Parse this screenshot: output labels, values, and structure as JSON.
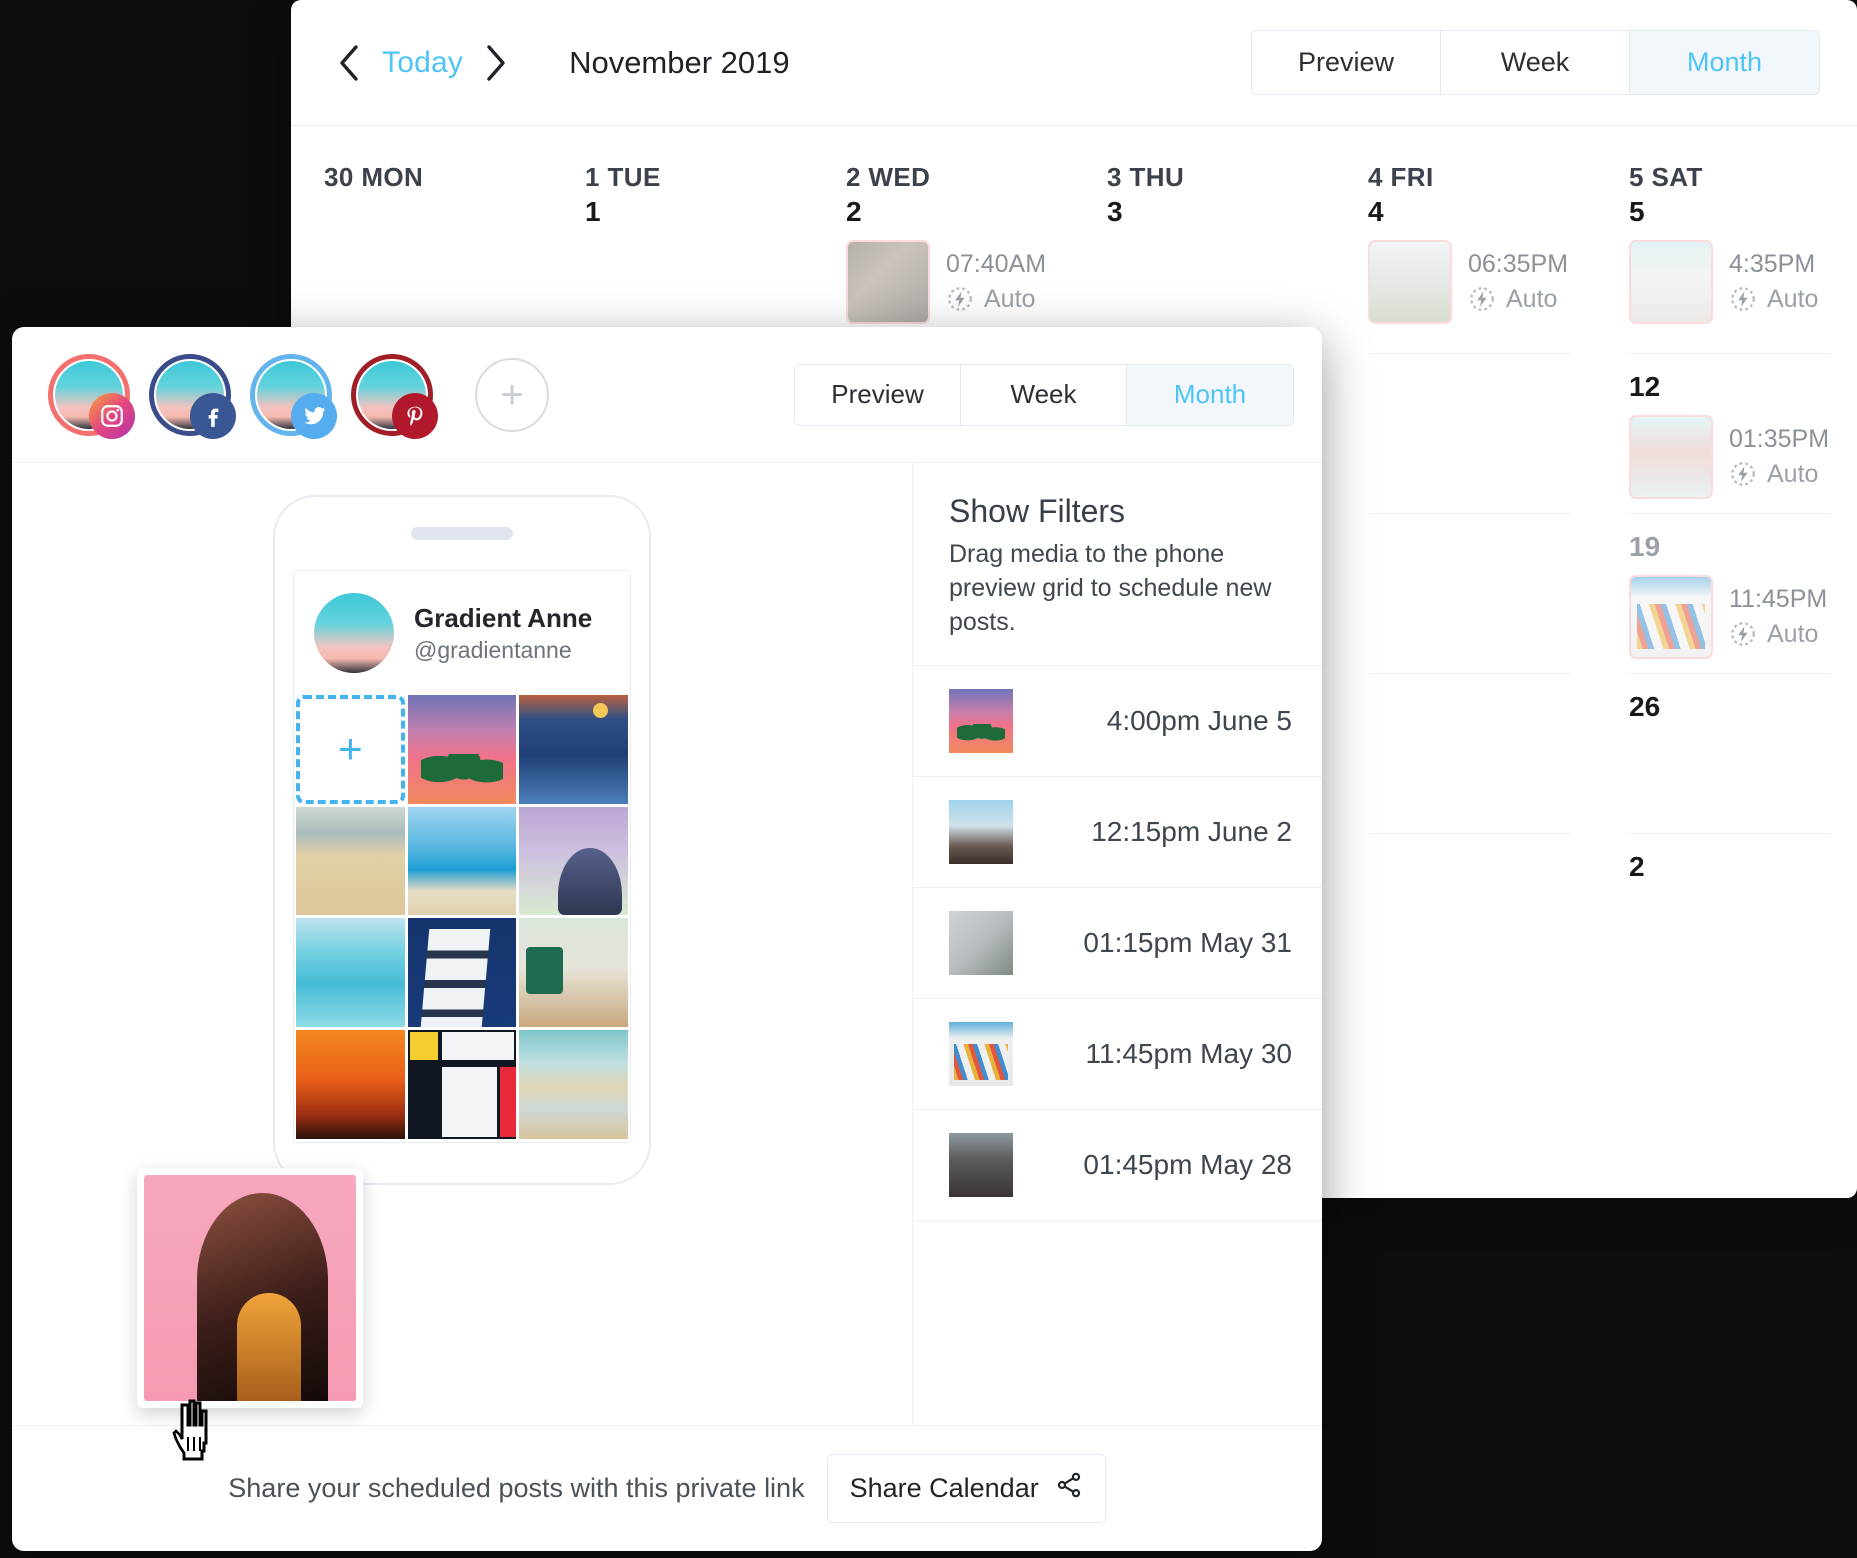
{
  "calendar": {
    "nav": {
      "prev": "‹",
      "today": "Today",
      "next": "›"
    },
    "title": "November 2019",
    "view_tabs": [
      {
        "label": "Preview",
        "active": false
      },
      {
        "label": "Week",
        "active": false
      },
      {
        "label": "Month",
        "active": true
      }
    ],
    "columns": [
      {
        "header": "30 MON",
        "weeks": [
          {
            "daynum": "",
            "posts": []
          },
          {
            "daynum": "",
            "posts": []
          },
          {
            "daynum": "",
            "posts": []
          },
          {
            "daynum": "",
            "posts": []
          },
          {
            "daynum": "",
            "posts": []
          }
        ]
      },
      {
        "header": "1 TUE",
        "weeks": [
          {
            "daynum": "1",
            "posts": []
          },
          {
            "daynum": "",
            "posts": []
          },
          {
            "daynum": "",
            "posts": []
          },
          {
            "daynum": "",
            "posts": []
          },
          {
            "daynum": "",
            "posts": []
          }
        ]
      },
      {
        "header": "2 WED",
        "weeks": [
          {
            "daynum": "2",
            "posts": [
              {
                "time": "07:40AM",
                "auto": "Auto",
                "thumb": "ph-brunch"
              }
            ]
          },
          {
            "daynum": "",
            "posts": []
          },
          {
            "daynum": "",
            "posts": []
          },
          {
            "daynum": "",
            "posts": []
          },
          {
            "daynum": "",
            "posts": []
          }
        ]
      },
      {
        "header": "3 THU",
        "weeks": [
          {
            "daynum": "3",
            "posts": []
          },
          {
            "daynum": "",
            "posts": []
          },
          {
            "daynum": "",
            "posts": []
          },
          {
            "daynum": "",
            "posts": []
          },
          {
            "daynum": "",
            "posts": []
          }
        ]
      },
      {
        "header": "4 FRI",
        "weeks": [
          {
            "daynum": "4",
            "posts": [
              {
                "time": "06:35PM",
                "auto": "Auto",
                "thumb": "ph-street"
              }
            ]
          },
          {
            "daynum": "",
            "posts": []
          },
          {
            "daynum": "",
            "posts": []
          },
          {
            "daynum": "",
            "posts": []
          },
          {
            "daynum": "",
            "posts": []
          }
        ]
      },
      {
        "header": "5 SAT",
        "weeks": [
          {
            "daynum": "5",
            "posts": [
              {
                "time": "4:35PM",
                "auto": "Auto",
                "thumb": "ph-sandals"
              }
            ]
          },
          {
            "daynum": "12",
            "posts": [
              {
                "time": "01:35PM",
                "auto": "Auto",
                "thumb": "ph-drinks"
              }
            ]
          },
          {
            "daynum": "19",
            "muted": true,
            "posts": [
              {
                "time": "11:45PM",
                "auto": "Auto",
                "thumb": "ph-mural"
              }
            ]
          },
          {
            "daynum": "26",
            "posts": []
          },
          {
            "daynum": "2",
            "posts": []
          }
        ]
      }
    ]
  },
  "composer": {
    "accounts": [
      {
        "network": "instagram",
        "ring": "#f4706e",
        "badge_bg": "linear-gradient(135deg,#f9a23b,#e4467f,#b033a8)"
      },
      {
        "network": "facebook",
        "ring": "#3b4c8a",
        "badge_bg": "#3a5795"
      },
      {
        "network": "twitter",
        "ring": "#63b3ec",
        "badge_bg": "#55acee"
      },
      {
        "network": "pinterest",
        "ring": "#a01e28",
        "badge_bg": "#b2182b"
      }
    ],
    "add_account_label": "+",
    "view_tabs": [
      {
        "label": "Preview",
        "active": false
      },
      {
        "label": "Week",
        "active": false
      },
      {
        "label": "Month",
        "active": true
      }
    ],
    "profile": {
      "name": "Gradient Anne",
      "handle": "@gradientanne"
    },
    "dropzone_label": "+",
    "grid_cells": [
      "ph-palms",
      "ph-moon",
      "ph-beach1",
      "ph-beach2",
      "ph-gherkin",
      "ph-swim",
      "ph-bldg",
      "ph-room",
      "ph-la",
      "ph-mondrian",
      "ph-shore"
    ],
    "dragged_item": {
      "thumb": "ph-arch"
    },
    "filters": {
      "title": "Show Filters",
      "subtitle": "Drag media to the phone preview grid to schedule new posts.",
      "rows": [
        {
          "time": "4:00pm June 5",
          "thumb": "ph-palms"
        },
        {
          "time": "12:15pm June 2",
          "thumb": "ph-phototaker"
        },
        {
          "time": "01:15pm May 31",
          "thumb": "ph-picnic"
        },
        {
          "time": "11:45pm May 30",
          "thumb": "ph-mural"
        },
        {
          "time": "01:45pm May 28",
          "thumb": "ph-girl"
        }
      ]
    },
    "footer": {
      "note": "Share your scheduled posts with this private link",
      "button": "Share Calendar"
    }
  },
  "colors": {
    "accent": "#4ec3f7",
    "dropzone": "#44b3ef",
    "post_border": "#f8bfbf",
    "page_bg": "#0d0d0d"
  }
}
